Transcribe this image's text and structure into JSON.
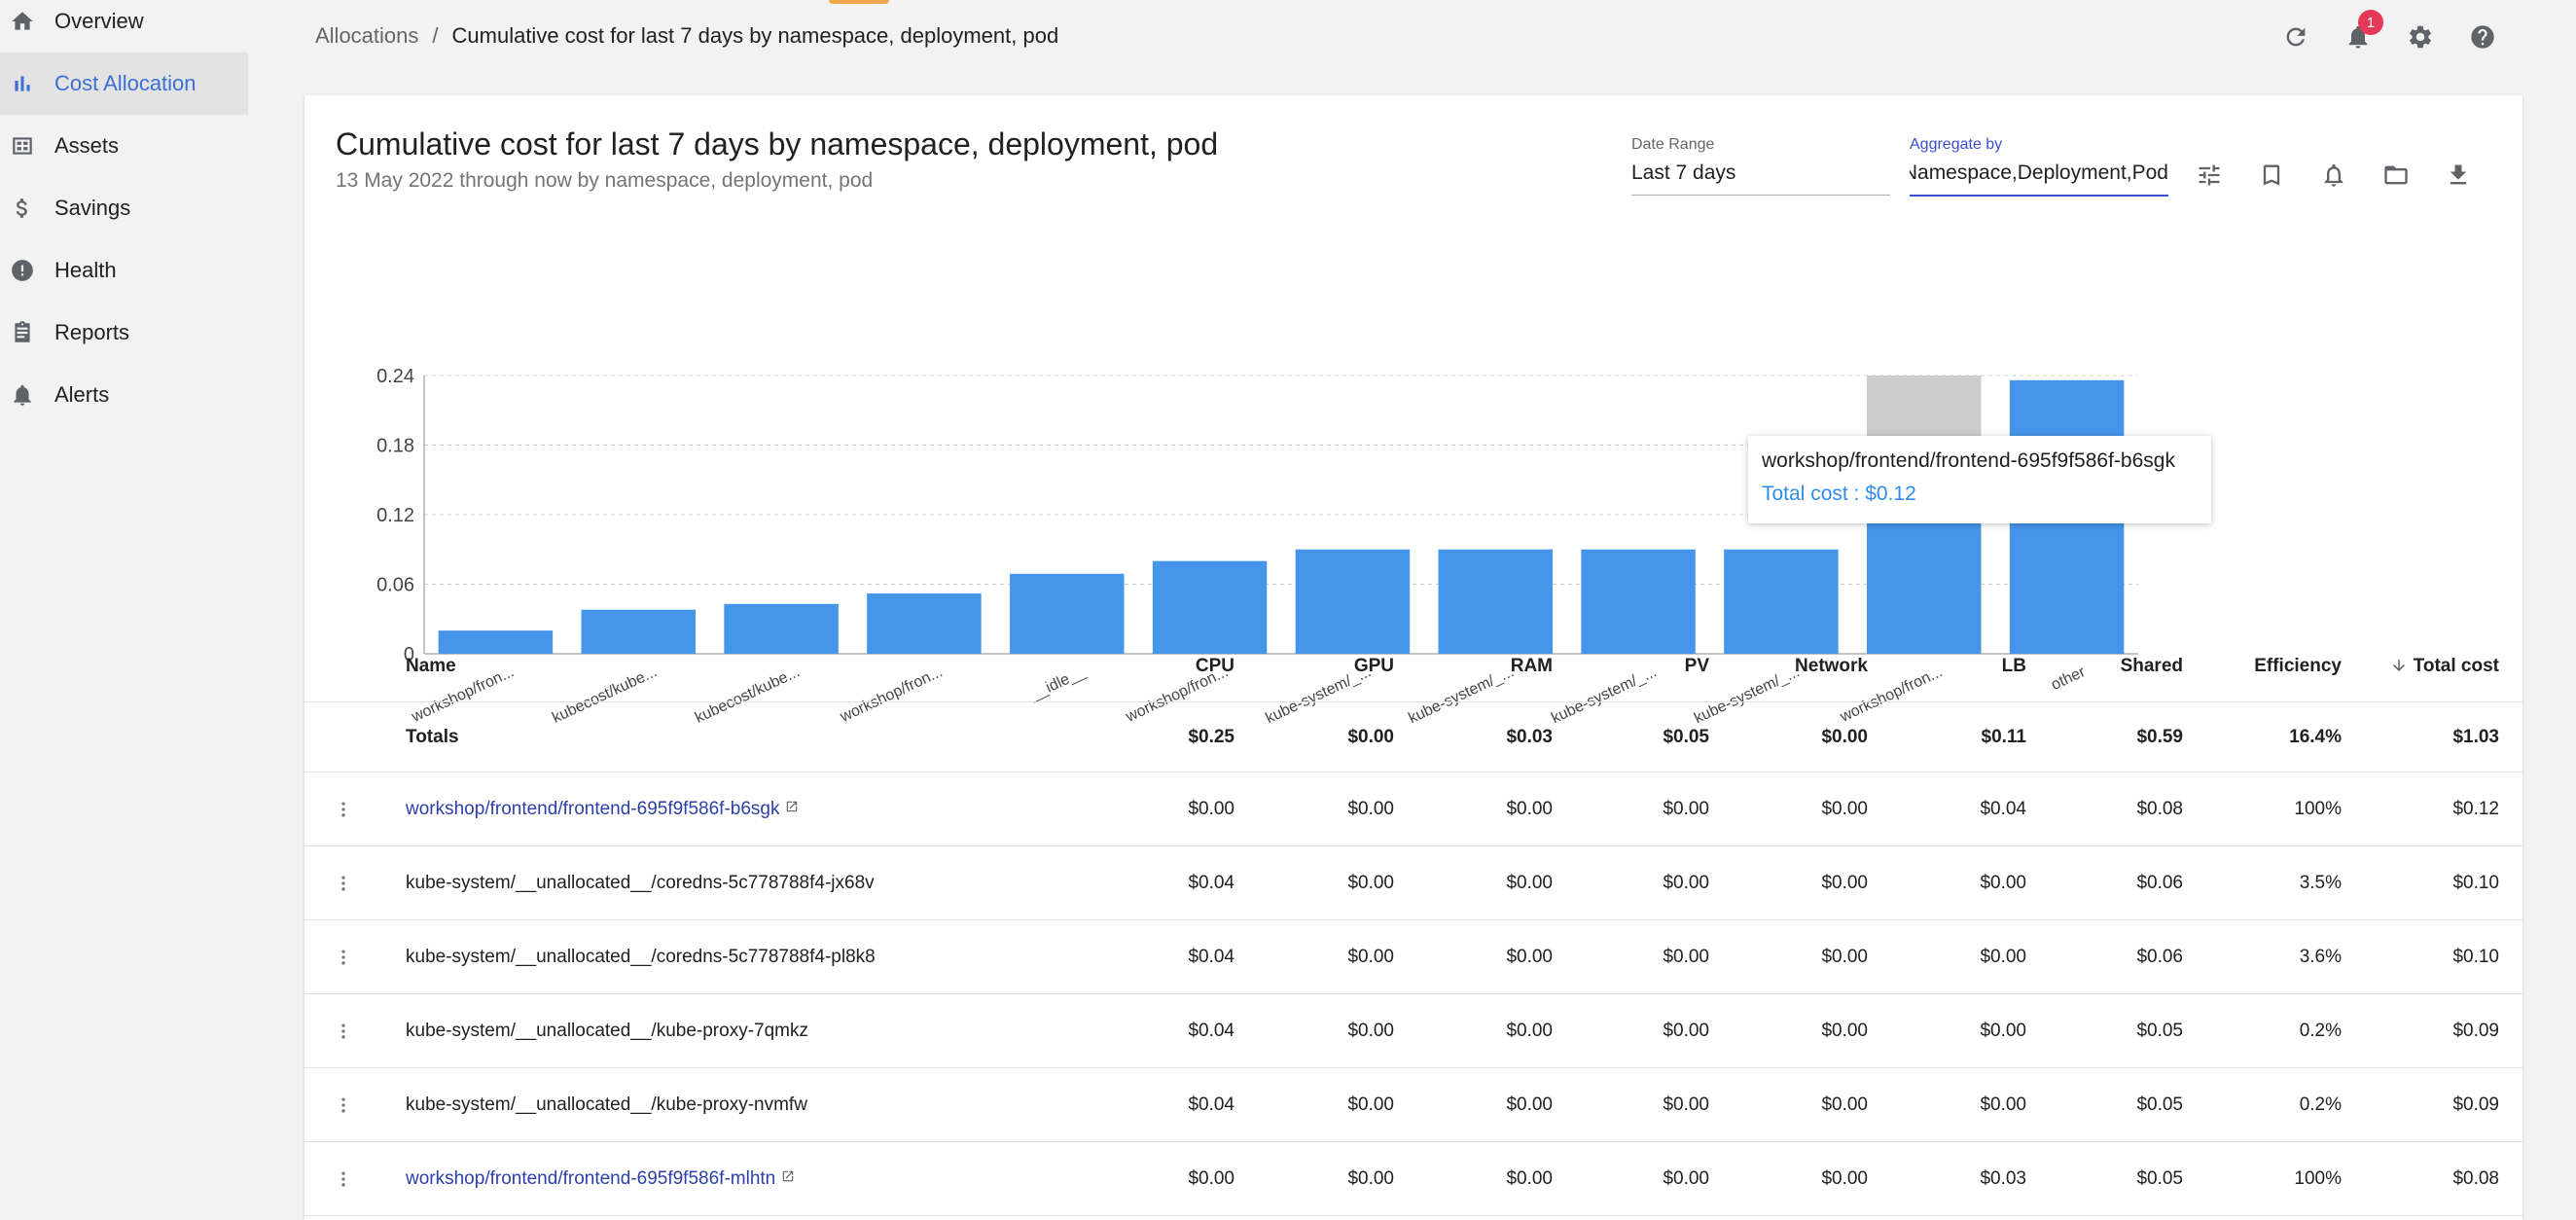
{
  "sidebar": {
    "items": [
      {
        "label": "Overview",
        "icon": "home-icon"
      },
      {
        "label": "Cost Allocation",
        "icon": "bar-chart-icon",
        "active": true
      },
      {
        "label": "Assets",
        "icon": "assets-icon"
      },
      {
        "label": "Savings",
        "icon": "dollar-icon"
      },
      {
        "label": "Health",
        "icon": "health-alert-icon"
      },
      {
        "label": "Reports",
        "icon": "clipboard-icon"
      },
      {
        "label": "Alerts",
        "icon": "bell-icon"
      }
    ]
  },
  "breadcrumb": {
    "parent": "Allocations",
    "separator": "/",
    "current": "Cumulative cost for last 7 days by namespace, deployment, pod"
  },
  "topbar": {
    "notification_count": "1"
  },
  "report": {
    "title": "Cumulative cost for last 7 days by namespace, deployment, pod",
    "subtitle": "13 May 2022 through now by namespace, deployment, pod",
    "date_range_label": "Date Range",
    "date_range_value": "Last 7 days",
    "aggregate_label": "Aggregate by",
    "aggregate_value": "Namespace,Deployment,Pod"
  },
  "chart_data": {
    "type": "bar",
    "categories": [
      "workshop/fron...",
      "kubecost/kube...",
      "kubecost/kube...",
      "workshop/fron...",
      "__idle__",
      "workshop/fron...",
      "kube-system/_...",
      "kube-system/_...",
      "kube-system/_...",
      "kube-system/_...",
      "workshop/fron...",
      "other"
    ],
    "values": [
      0.02,
      0.038,
      0.043,
      0.052,
      0.069,
      0.08,
      0.09,
      0.09,
      0.09,
      0.09,
      0.118,
      0.236
    ],
    "ylim": [
      0,
      0.24
    ],
    "yticks": [
      "0",
      "0.06",
      "0.12",
      "0.18",
      "0.24"
    ],
    "grid": true,
    "highlighted_index": 10,
    "bar_color": "#4595ea",
    "highlight_color": "#cccccc"
  },
  "tooltip": {
    "name": "workshop/frontend/frontend-695f9f586f-b6sgk",
    "cost": "Total cost : $0.12"
  },
  "table": {
    "columns": [
      "Name",
      "CPU",
      "GPU",
      "RAM",
      "PV",
      "Network",
      "LB",
      "Shared",
      "Efficiency",
      "Total cost"
    ],
    "totals": [
      "Totals",
      "$0.25",
      "$0.00",
      "$0.03",
      "$0.05",
      "$0.00",
      "$0.11",
      "$0.59",
      "16.4%",
      "$1.03"
    ],
    "rows": [
      {
        "link": true,
        "cells": [
          "workshop/frontend/frontend-695f9f586f-b6sgk",
          "$0.00",
          "$0.00",
          "$0.00",
          "$0.00",
          "$0.00",
          "$0.04",
          "$0.08",
          "100%",
          "$0.12"
        ]
      },
      {
        "link": false,
        "cells": [
          "kube-system/__unallocated__/coredns-5c778788f4-jx68v",
          "$0.04",
          "$0.00",
          "$0.00",
          "$0.00",
          "$0.00",
          "$0.00",
          "$0.06",
          "3.5%",
          "$0.10"
        ]
      },
      {
        "link": false,
        "cells": [
          "kube-system/__unallocated__/coredns-5c778788f4-pl8k8",
          "$0.04",
          "$0.00",
          "$0.00",
          "$0.00",
          "$0.00",
          "$0.00",
          "$0.06",
          "3.6%",
          "$0.10"
        ]
      },
      {
        "link": false,
        "cells": [
          "kube-system/__unallocated__/kube-proxy-7qmkz",
          "$0.04",
          "$0.00",
          "$0.00",
          "$0.00",
          "$0.00",
          "$0.00",
          "$0.05",
          "0.2%",
          "$0.09"
        ]
      },
      {
        "link": false,
        "cells": [
          "kube-system/__unallocated__/kube-proxy-nvmfw",
          "$0.04",
          "$0.00",
          "$0.00",
          "$0.00",
          "$0.00",
          "$0.00",
          "$0.05",
          "0.2%",
          "$0.09"
        ]
      },
      {
        "link": true,
        "cells": [
          "workshop/frontend/frontend-695f9f586f-mlhtn",
          "$0.00",
          "$0.00",
          "$0.00",
          "$0.00",
          "$0.00",
          "$0.03",
          "$0.05",
          "100%",
          "$0.08"
        ]
      }
    ]
  }
}
